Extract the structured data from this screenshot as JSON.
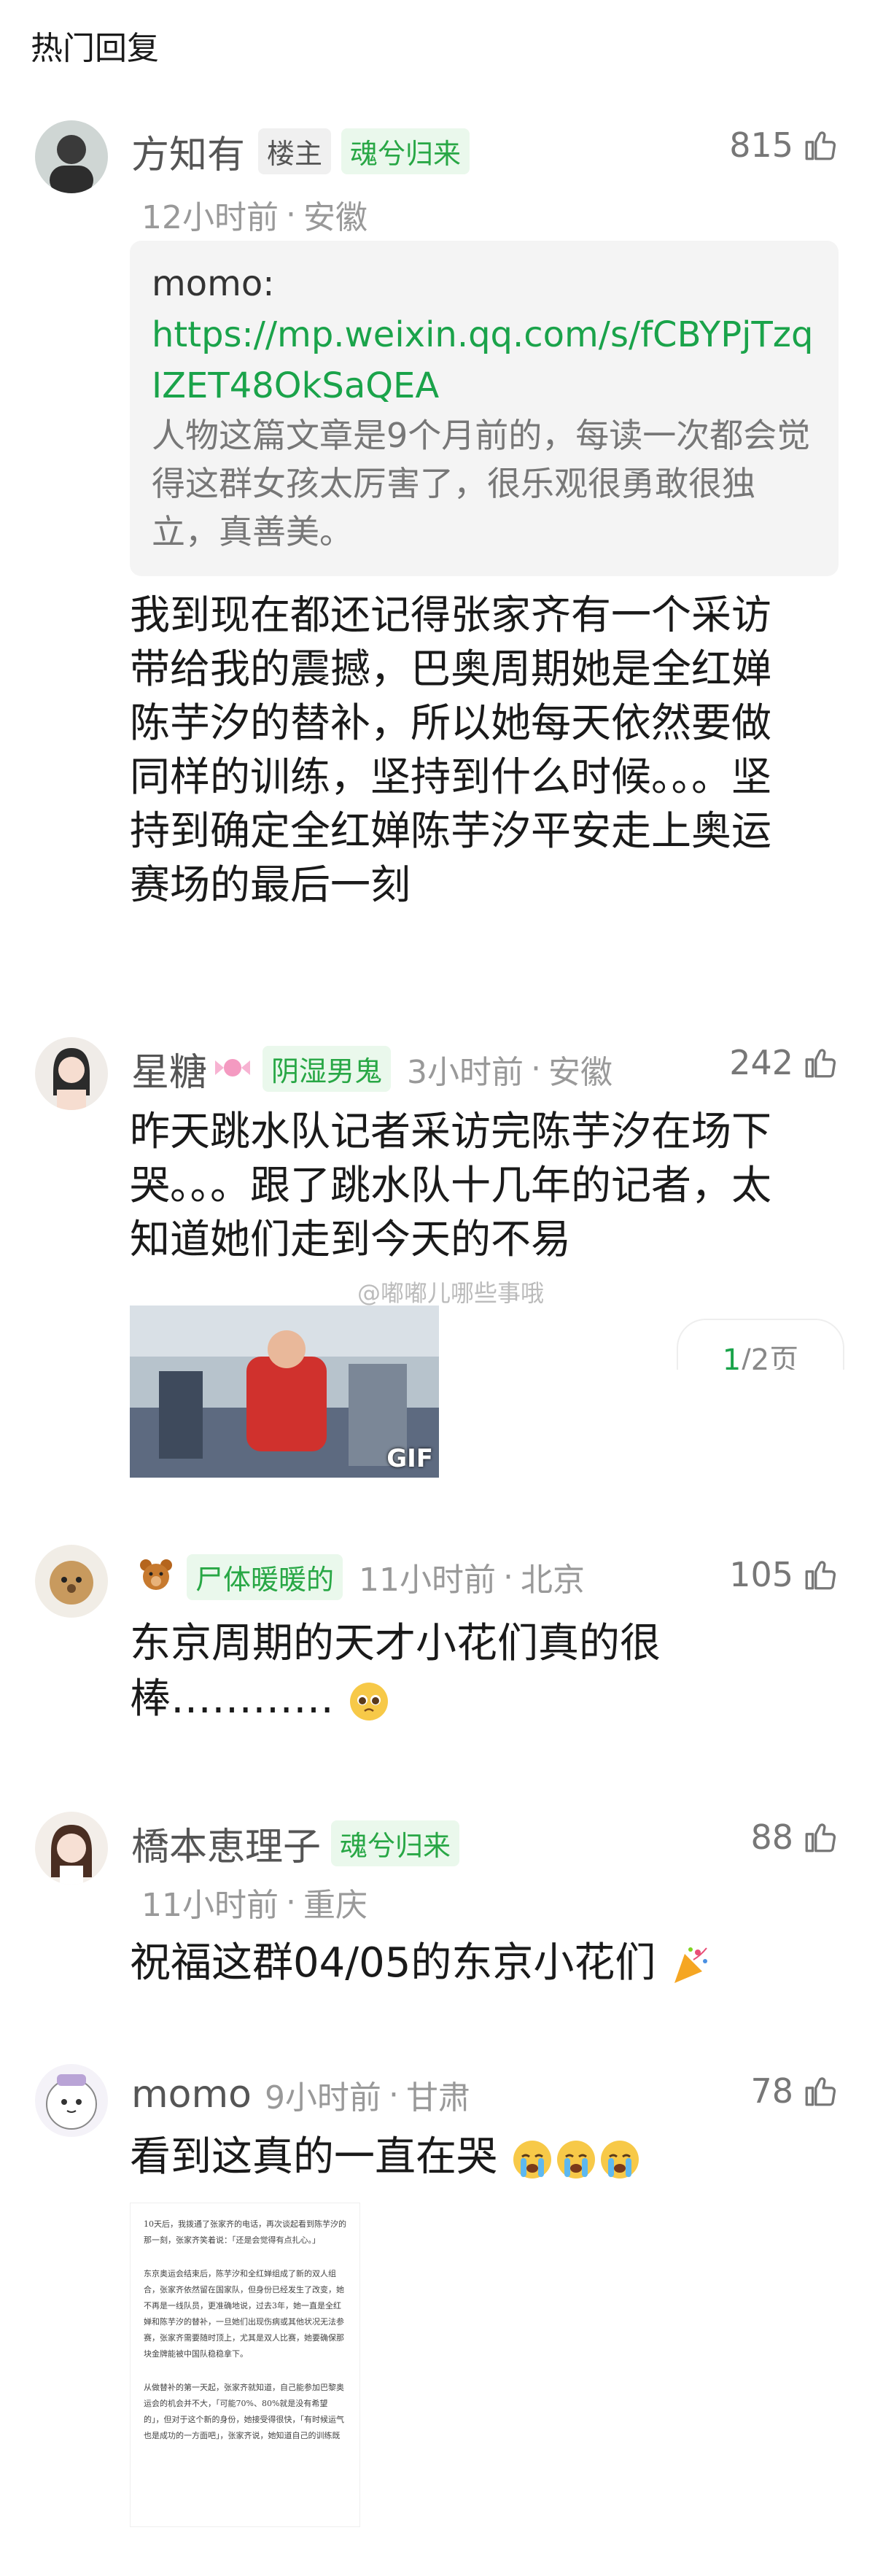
{
  "header": {
    "title": "热门回复"
  },
  "comments": [
    {
      "name": "方知有",
      "host_tag": "楼主",
      "badge": "魂兮归来",
      "time": "12小时前",
      "location": "安徽",
      "likes": "815",
      "quote": {
        "author": "momo:",
        "link": "https://mp.weixin.qq.com/s/fCBYPjTzqIZET48OkSaQEA",
        "text": "人物这篇文章是9个月前的，每读一次都会觉得这群女孩太厉害了，很乐观很勇敢很独立，真善美。"
      },
      "text": "我到现在都还记得张家齐有一个采访带给我的震撼，巴奥周期她是全红婵陈芋汐的替补，所以她每天依然要做同样的训练，坚持到什么时候。。。坚持到确定全红婵陈芋汐平安走上奥运赛场的最后一刻"
    },
    {
      "name": "星糖",
      "badge": "阴湿男鬼",
      "time": "3小时前",
      "location": "安徽",
      "likes": "242",
      "text": "昨天跳水队记者采访完陈芋汐在场下哭。。。跟了跳水队十几年的记者，太知道她们走到今天的不易",
      "image_label": "GIF",
      "watermark": "@嘟嘟儿哪些事哦",
      "page_current": "1",
      "page_total": "/2页"
    },
    {
      "name": "",
      "badge": "尸体暖暖的",
      "time": "11小时前",
      "location": "北京",
      "likes": "105",
      "text": "东京周期的天才小花们真的很棒…………"
    },
    {
      "name": "橋本恵理子",
      "badge": "魂兮归来",
      "time": "11小时前",
      "location": "重庆",
      "likes": "88",
      "text": "祝福这群04/05的东京小花们"
    },
    {
      "name": "momo",
      "time": "9小时前",
      "location": "甘肃",
      "likes": "78",
      "text": "看到这真的一直在哭",
      "doc_paragraphs": [
        "10天后，我拨通了张家齐的电话，再次谈起看到陈芋汐的那一刻，张家齐笑着说：「还是会觉得有点扎心。」",
        "东京奥运会结束后，陈芋汐和全红婵组成了新的双人组合，张家齐依然留在国家队，但身份已经发生了改变，她不再是一线队员，更准确地说，过去3年，她一直是全红婵和陈芋汐的替补，一旦她们出现伤病或其他状况无法参赛，张家齐需要随时顶上，尤其是双人比赛，她要确保那块金牌能被中国队稳稳拿下。",
        "从做替补的第一天起，张家齐就知道，自己能参加巴黎奥运会的机会并不大，「可能70%、80%就是没有希望的」，但对于这个新的身份，她接受得很快，「有时候运气也是成功的一方面吧」，张家齐说，她知道自己的训练既"
      ]
    }
  ]
}
